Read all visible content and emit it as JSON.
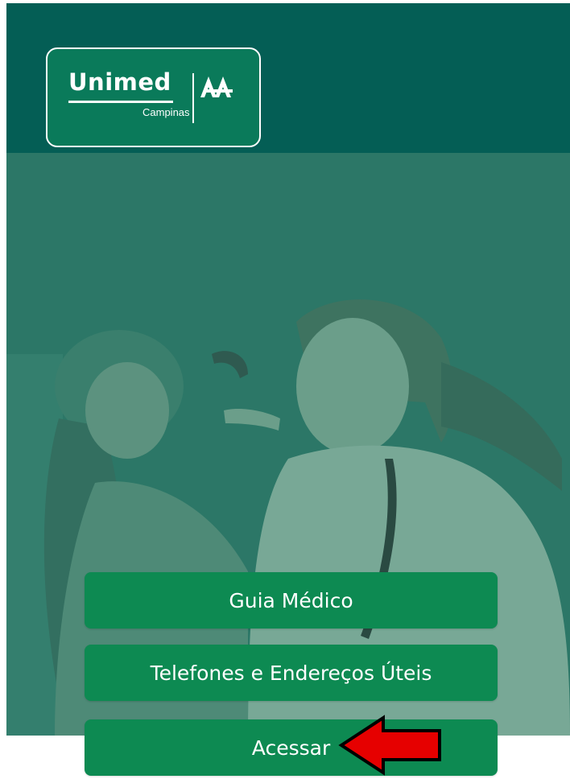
{
  "brand": {
    "name": "Unimed",
    "region": "Campinas",
    "colors": {
      "header": "#045e55",
      "hero": "#2a7565",
      "button": "#0d8a52",
      "annotation_arrow": "#e60000"
    }
  },
  "menu": {
    "items": [
      {
        "id": "guia",
        "label": "Guia Médico"
      },
      {
        "id": "telefones",
        "label": "Telefones e Endereços Úteis"
      },
      {
        "id": "acessar",
        "label": "Acessar"
      }
    ]
  },
  "icons": {
    "logo_mark": "unimed-trees-icon",
    "annotation": "left-arrow-icon"
  }
}
